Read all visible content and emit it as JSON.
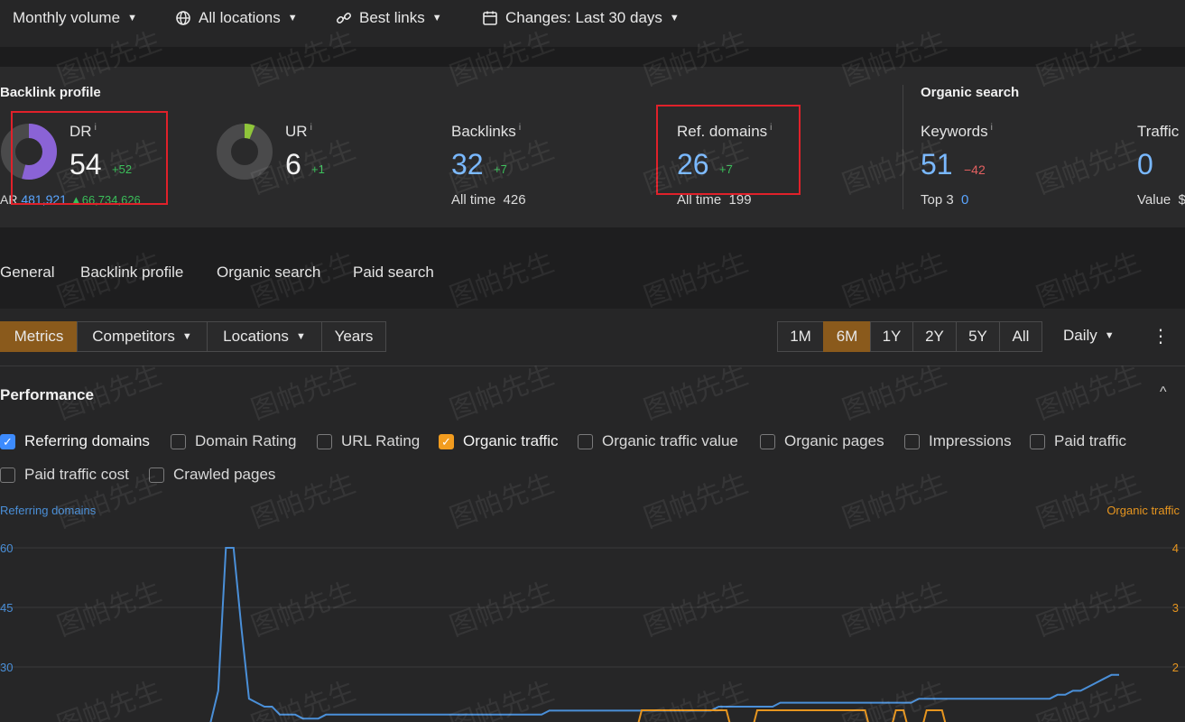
{
  "topbar": {
    "volume": "Monthly volume",
    "locations": "All locations",
    "links": "Best links",
    "changes": "Changes: Last 30 days"
  },
  "backlink_profile": {
    "title": "Backlink profile",
    "dr": {
      "label": "DR",
      "info": "i",
      "value": "54",
      "delta": "+52",
      "ar_label": "AR",
      "ar_value": "481,921",
      "ar_delta": "▲66,734,626",
      "ring_fraction": 0.54
    },
    "ur": {
      "label": "UR",
      "info": "i",
      "value": "6",
      "delta": "+1",
      "ring_fraction": 0.06
    },
    "backlinks": {
      "label": "Backlinks",
      "info": "i",
      "value": "32",
      "delta": "+7",
      "all_time_label": "All time",
      "all_time_value": "426"
    },
    "ref_domains": {
      "label": "Ref. domains",
      "info": "i",
      "value": "26",
      "delta": "+7",
      "all_time_label": "All time",
      "all_time_value": "199"
    }
  },
  "organic_search": {
    "title": "Organic search",
    "keywords": {
      "label": "Keywords",
      "info": "i",
      "value": "51",
      "delta": "−42",
      "top3_label": "Top 3",
      "top3_value": "0"
    },
    "traffic": {
      "label": "Traffic",
      "value": "0",
      "value_label": "Value",
      "value_value": "$"
    }
  },
  "tabs": [
    "General",
    "Backlink profile",
    "Organic search",
    "Paid search"
  ],
  "toolbar": {
    "left": [
      "Metrics",
      "Competitors",
      "Locations",
      "Years"
    ],
    "ranges": [
      "1M",
      "6M",
      "1Y",
      "2Y",
      "5Y",
      "All"
    ],
    "active_range": "6M",
    "interval": "Daily",
    "more": "⋮"
  },
  "performance": {
    "title": "Performance",
    "collapse": "^",
    "checkboxes": [
      {
        "label": "Referring domains",
        "checked": true,
        "color": "#3d8bfd"
      },
      {
        "label": "Domain Rating",
        "checked": false
      },
      {
        "label": "URL Rating",
        "checked": false
      },
      {
        "label": "Organic traffic",
        "checked": true,
        "color": "#f29c1f"
      },
      {
        "label": "Organic traffic value",
        "checked": false
      },
      {
        "label": "Organic pages",
        "checked": false
      },
      {
        "label": "Impressions",
        "checked": false
      },
      {
        "label": "Paid traffic",
        "checked": false
      },
      {
        "label": "Paid traffic cost",
        "checked": false
      },
      {
        "label": "Crawled pages",
        "checked": false
      }
    ]
  },
  "chart_data": {
    "type": "line",
    "left_axis_label": "Referring domains",
    "right_axis_label": "Organic traffic",
    "left_ticks": [
      "60",
      "45",
      "30"
    ],
    "right_ticks": [
      "4",
      "3",
      "2"
    ],
    "left_range": [
      15,
      60
    ],
    "right_range": [
      1,
      4
    ],
    "series": [
      {
        "name": "Referring domains",
        "color": "#4a8fd8",
        "axis": "left",
        "values": [
          15,
          15,
          15,
          15,
          15,
          15,
          15,
          15,
          16,
          24,
          60,
          60,
          40,
          22,
          21,
          20,
          20,
          18,
          18,
          18,
          17,
          17,
          17,
          18,
          18,
          18,
          18,
          18,
          18,
          18,
          18,
          18,
          18,
          18,
          18,
          18,
          18,
          18,
          18,
          18,
          18,
          18,
          18,
          18,
          18,
          18,
          18,
          18,
          18,
          18,
          18,
          18,
          19,
          19,
          19,
          19,
          19,
          19,
          19,
          19,
          19,
          19,
          19,
          19,
          19,
          19,
          19,
          19,
          19,
          19,
          19,
          19,
          19,
          19,
          20,
          20,
          20,
          20,
          20,
          20,
          20,
          20,
          21,
          21,
          21,
          21,
          21,
          21,
          21,
          21,
          21,
          21,
          21,
          21,
          21,
          21,
          21,
          21,
          21,
          21,
          22,
          22,
          22,
          22,
          22,
          22,
          22,
          22,
          22,
          22,
          22,
          22,
          22,
          22,
          22,
          22,
          22,
          22,
          23,
          23,
          24,
          24,
          25,
          26,
          27,
          28,
          28
        ]
      },
      {
        "name": "Organic traffic",
        "color": "#e6951f",
        "axis": "right",
        "values": [
          0,
          0,
          0,
          0,
          0,
          0,
          0,
          0,
          0,
          0,
          0,
          0,
          0,
          0,
          0,
          0,
          0,
          0,
          0,
          0,
          0,
          0,
          0,
          0,
          0,
          0,
          0,
          0,
          0,
          0,
          0,
          0,
          0,
          0,
          0,
          0,
          0,
          0,
          0,
          0,
          0,
          0,
          0,
          0,
          0,
          0,
          0,
          0,
          0,
          0,
          0,
          0,
          0,
          0,
          0,
          0,
          0,
          0,
          0,
          0,
          0,
          0,
          0,
          0,
          1,
          1,
          1,
          1,
          1,
          1,
          1,
          1,
          1,
          1,
          1,
          1,
          0,
          0,
          0,
          1,
          1,
          1,
          1,
          1,
          1,
          1,
          1,
          1,
          1,
          1,
          1,
          1,
          1,
          1,
          0,
          0,
          0,
          1,
          1,
          0,
          0,
          1,
          1,
          1,
          0,
          0,
          0,
          0,
          0,
          0,
          0,
          0,
          0,
          0,
          0,
          0,
          0,
          0,
          0,
          0,
          0,
          0,
          0,
          0,
          0,
          0,
          0
        ]
      }
    ]
  },
  "watermark": "图帕先生"
}
